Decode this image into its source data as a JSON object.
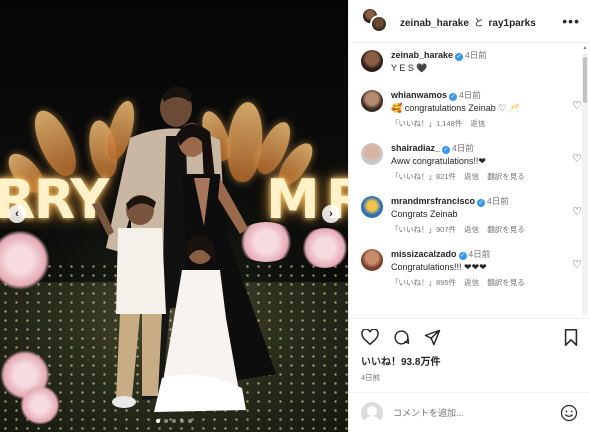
{
  "post": {
    "header": {
      "author1": "zeinab_harake",
      "joiner": "と",
      "author2": "ray1parks",
      "more_icon": "more-horizontal-icon"
    },
    "caption": {
      "user": "zeinab_harake",
      "time": "4日前",
      "text": "Y E S 🖤"
    },
    "comments": [
      {
        "user": "whianwamos",
        "time": "4日前",
        "text": "🥰 congratulations Zeinab ♡ 🥂",
        "likes": "「いいね！」1,148件",
        "reply": "返信",
        "translate": ""
      },
      {
        "user": "shairadiaz_",
        "time": "4日前",
        "text": "Aww congratulations!!❤",
        "likes": "「いいね！」821件",
        "reply": "返信",
        "translate": "翻訳を見る"
      },
      {
        "user": "mrandmrsfrancisco",
        "time": "4日前",
        "text": "Congrats Zeinab",
        "likes": "「いいね！」907件",
        "reply": "返信",
        "translate": "翻訳を見る"
      },
      {
        "user": "missizacalzado",
        "time": "4日前",
        "text": "Congratulations!!! ❤❤❤",
        "likes": "「いいね！」895件",
        "reply": "返信",
        "translate": "翻訳を見る"
      }
    ],
    "actions": {
      "like_icon": "heart-icon",
      "comment_icon": "comment-icon",
      "share_icon": "paper-plane-icon",
      "save_icon": "bookmark-icon"
    },
    "likes_text": "いいね！93.8万件",
    "date_text": "4日前",
    "composer": {
      "placeholder": "コメントを追加...",
      "emoji_icon": "smiley-icon"
    },
    "photo": {
      "sign_letters_left": "RRY",
      "sign_letters_right": "M",
      "sign_letters_edge": "R",
      "prev_icon": "chevron-left-icon",
      "next_icon": "chevron-right-icon",
      "carousel_pages": 5,
      "carousel_active": 1
    },
    "colors": {
      "verified": "#3897f0",
      "secondary_text": "#737373",
      "divider": "#efefef"
    }
  }
}
